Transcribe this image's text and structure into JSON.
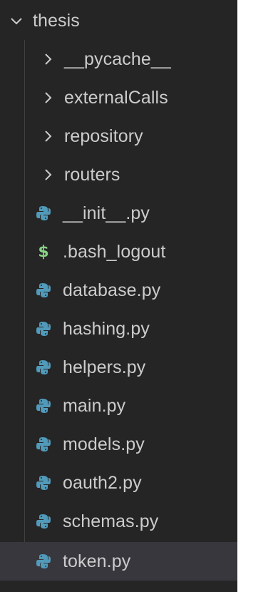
{
  "explorer": {
    "root": {
      "label": "thesis",
      "expanded": true,
      "icon": "chevron-down-icon"
    },
    "folders": [
      {
        "label": "__pycache__",
        "icon": "chevron-right-icon"
      },
      {
        "label": "externalCalls",
        "icon": "chevron-right-icon"
      },
      {
        "label": "repository",
        "icon": "chevron-right-icon"
      },
      {
        "label": "routers",
        "icon": "chevron-right-icon"
      }
    ],
    "files": [
      {
        "label": "__init__.py",
        "icon": "python-icon"
      },
      {
        "label": ".bash_logout",
        "icon": "shell-icon",
        "glyph": "$"
      },
      {
        "label": "database.py",
        "icon": "python-icon"
      },
      {
        "label": "hashing.py",
        "icon": "python-icon"
      },
      {
        "label": "helpers.py",
        "icon": "python-icon"
      },
      {
        "label": "main.py",
        "icon": "python-icon"
      },
      {
        "label": "models.py",
        "icon": "python-icon"
      },
      {
        "label": "oauth2.py",
        "icon": "python-icon"
      },
      {
        "label": "schemas.py",
        "icon": "python-icon"
      },
      {
        "label": "token.py",
        "icon": "python-icon",
        "selected": true
      }
    ],
    "colors": {
      "background": "#252526",
      "text": "#cccccc",
      "selected_row": "#37373d",
      "python_icon": "#519aba",
      "shell_icon": "#89d185"
    }
  }
}
